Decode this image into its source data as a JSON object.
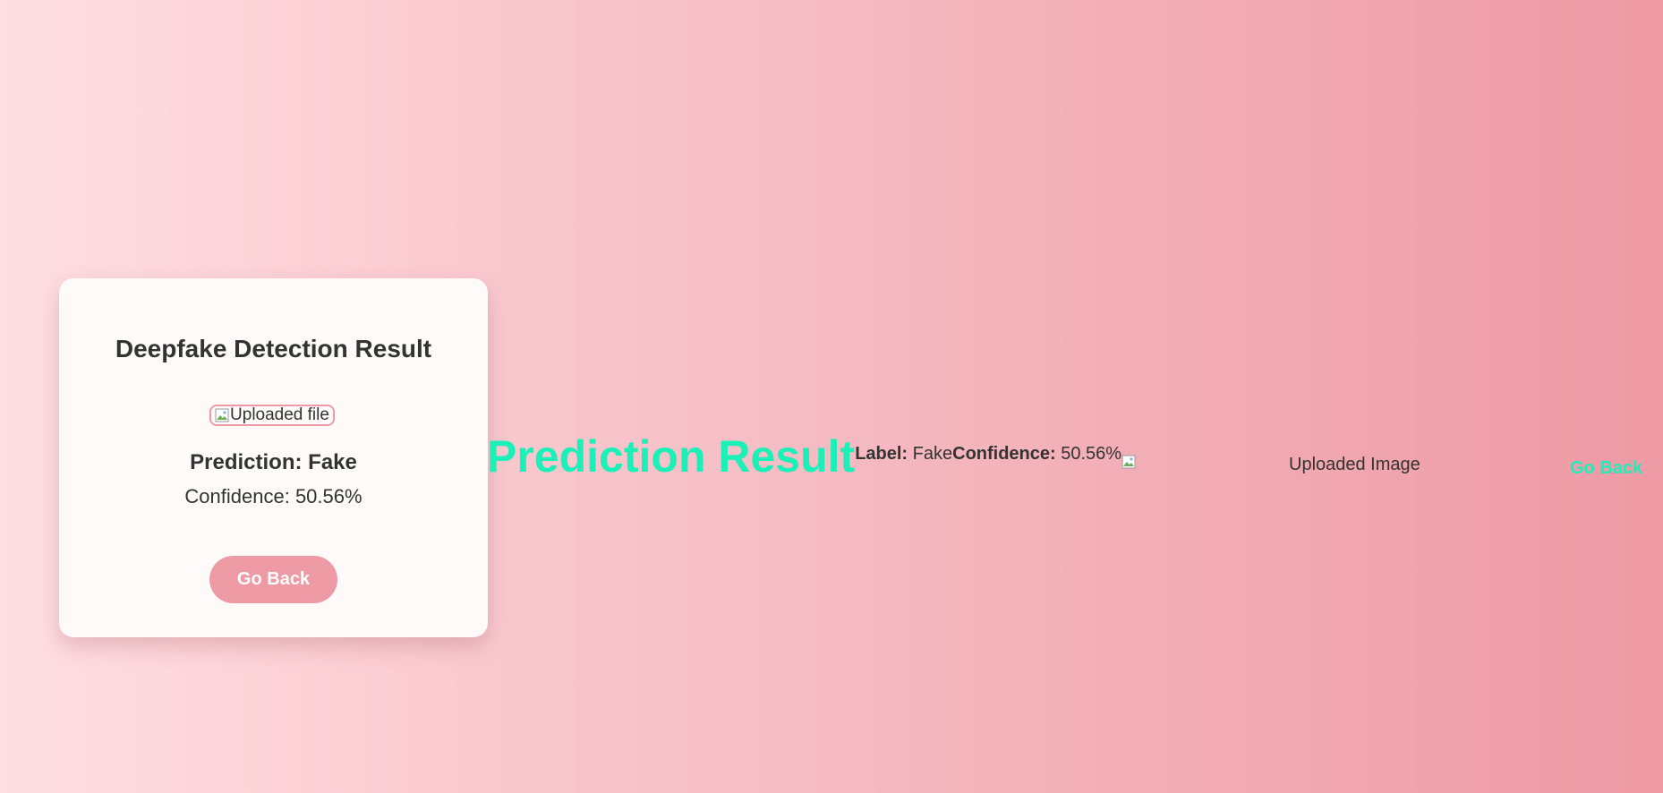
{
  "card": {
    "title": "Deepfake Detection Result",
    "image_alt": "Uploaded file",
    "prediction": "Prediction: Fake",
    "confidence": "Confidence: 50.56%",
    "button_label": "Go Back"
  },
  "unstyled": {
    "heading": "Prediction Result",
    "label_key": "Label:",
    "label_value": "Fake",
    "confidence_key": "Confidence:",
    "confidence_value": "50.56%",
    "image_alt": "Uploaded Image",
    "link_label": "Go Back"
  },
  "colors": {
    "accent": "#ee9aa5",
    "heading_green": "#1af0b8",
    "text": "#333333",
    "card_bg": "#fffafa"
  },
  "icons": {
    "broken_image": "broken-image-icon"
  }
}
